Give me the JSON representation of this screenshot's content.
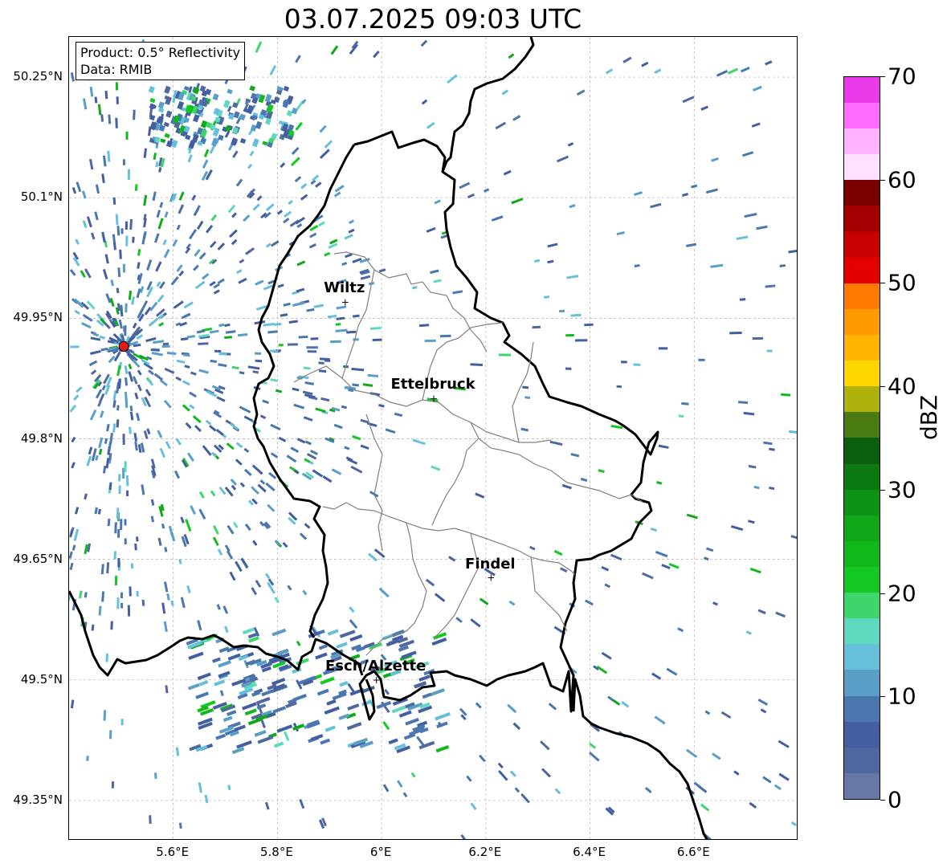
{
  "title": "03.07.2025 09:03 UTC",
  "info": {
    "product": "Product: 0.5° Reflectivity",
    "data": "Data: RMIB"
  },
  "lat_labels": [
    "50.25°N",
    "50.1°N",
    "49.95°N",
    "49.8°N",
    "49.65°N",
    "49.5°N",
    "49.35°N"
  ],
  "lat_values": [
    50.25,
    50.1,
    49.95,
    49.8,
    49.65,
    49.5,
    49.35
  ],
  "lon_labels": [
    "5.6°E",
    "5.8°E",
    "6°E",
    "6.2°E",
    "6.4°E",
    "6.6°E"
  ],
  "lon_values": [
    5.6,
    5.8,
    6.0,
    6.2,
    6.4,
    6.6
  ],
  "extent": {
    "lon": [
      5.4,
      6.8
    ],
    "lat": [
      49.3,
      50.3
    ]
  },
  "cities": [
    {
      "name": "Wiltz",
      "lon": 5.93,
      "lat": 49.97
    },
    {
      "name": "Ettelbruck",
      "lon": 6.1,
      "lat": 49.85
    },
    {
      "name": "Findel",
      "lon": 6.21,
      "lat": 49.627
    },
    {
      "name": "Esch/Alzette",
      "lon": 5.99,
      "lat": 49.5
    }
  ],
  "radar_site": {
    "lon": 5.505,
    "lat": 49.915,
    "color": "#e41a1c"
  },
  "colorbar": {
    "label": "dBZ",
    "min": 0,
    "max": 70,
    "ticks": [
      "0",
      "10",
      "20",
      "30",
      "40",
      "50",
      "60",
      "70"
    ],
    "colors": [
      "#6777a6",
      "#5068a0",
      "#445ea2",
      "#4a77af",
      "#5a9ec8",
      "#66c0db",
      "#5fd8c0",
      "#3ed66a",
      "#13c821",
      "#11b81b",
      "#10a718",
      "#0e9215",
      "#0b7a11",
      "#0a5e0d",
      "#4a7a12",
      "#afb20a",
      "#ffd700",
      "#ffb500",
      "#ff9a00",
      "#ff7a00",
      "#e50000",
      "#c80000",
      "#a50000",
      "#7a0000",
      "#ffe0ff",
      "#ffb3ff",
      "#ff6cff",
      "#e83ae8"
    ]
  },
  "border_color": "#000000",
  "canton_color": "#808080"
}
